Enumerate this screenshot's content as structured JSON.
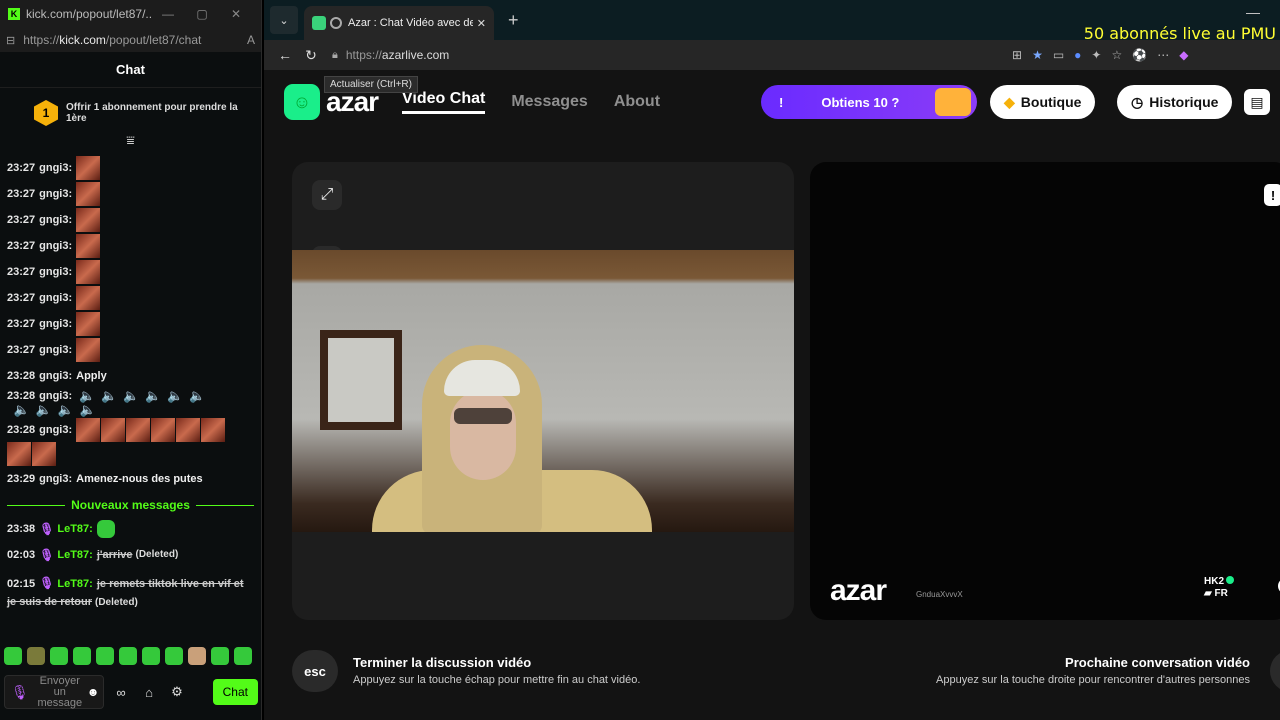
{
  "kick": {
    "window_title": "kick.com/popout/let87/...",
    "url_host": "https://kick.com/popout/let87/chat",
    "url_prefix": "https://",
    "url_domain": "kick.com",
    "url_path": "/popout/let87/chat",
    "chat_title": "Chat",
    "sub_badge": "1",
    "sub_text": "Offrir 1 abonnement pour prendre la 1ère",
    "messages": [
      {
        "time": "23:27",
        "user": "gngi3:"
      },
      {
        "time": "23:27",
        "user": "gngi3:"
      },
      {
        "time": "23:27",
        "user": "gngi3:"
      },
      {
        "time": "23:27",
        "user": "gngi3:"
      },
      {
        "time": "23:27",
        "user": "gngi3:"
      },
      {
        "time": "23:27",
        "user": "gngi3:"
      },
      {
        "time": "23:27",
        "user": "gngi3:"
      },
      {
        "time": "23:27",
        "user": "gngi3:"
      },
      {
        "time": "23:28",
        "user": "gngi3:",
        "text": "Apply"
      },
      {
        "time": "23:28",
        "user": "gngi3:"
      },
      {
        "time": "23:28",
        "user": "gngi3:"
      },
      {
        "time": "23:29",
        "user": "gngi3:",
        "text": "Amenez-nous des putes"
      }
    ],
    "divider": "Nouveaux messages",
    "new_messages": [
      {
        "time": "23:38",
        "user": "LeT87:"
      },
      {
        "time": "02:03",
        "user": "LeT87:",
        "text": "j'arrive",
        "tag": "(Deleted)"
      },
      {
        "time": "02:15",
        "user": "LeT87:",
        "text": "je remets tiktok live en vif et je suis de retour",
        "tag": "(Deleted)"
      }
    ],
    "input_placeholder": "Envoyer un message",
    "chat_button": "Chat"
  },
  "browser": {
    "tab_title": "Azar : Chat Vidéo avec de nou",
    "overlay_text": "50 abonnés live au PMU",
    "url_scheme": "https://",
    "url_host": "azarlive.com",
    "tooltip": "Actualiser (Ctrl+R)"
  },
  "azar": {
    "logo_word": "azar",
    "nav": [
      "Video Chat",
      "Messages",
      "About"
    ],
    "promo_mark": "!",
    "promo_text": "Obtiens 10 ?",
    "boutique": "Boutique",
    "historique": "Historique",
    "esc_label": "esc",
    "end_title": "Terminer la discussion vidéo",
    "end_sub": "Appuyez sur la touche échap pour mettre fin au chat vidéo.",
    "next_title": "Prochaine conversation vidéo",
    "next_sub": "Appuyez sur la touche droite pour rencontrer d'autres personnes",
    "watermark": "azar",
    "partner_user": "GnduaXvvvX",
    "region_code": "HK2",
    "country": "FR"
  }
}
